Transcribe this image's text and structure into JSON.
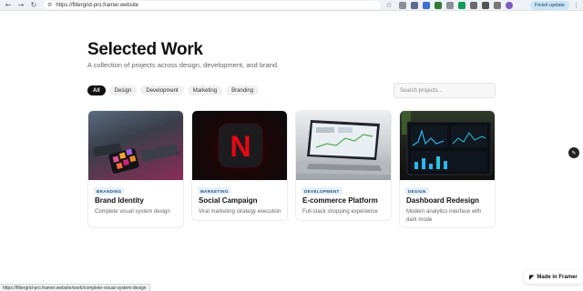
{
  "browser": {
    "url": "https://filtergrid-pro.framer.website",
    "finish_update_label": "Finish update",
    "status_url": "https://filtergrid-pro.framer.website/work/complete-visual-system-design"
  },
  "header": {
    "title": "Selected Work",
    "subtitle": "A collection of projects across design, development, and brand."
  },
  "filters": [
    {
      "label": "All",
      "active": true
    },
    {
      "label": "Design",
      "active": false
    },
    {
      "label": "Development",
      "active": false
    },
    {
      "label": "Marketing",
      "active": false
    },
    {
      "label": "Branding",
      "active": false
    }
  ],
  "search": {
    "placeholder": "Search projects..."
  },
  "projects": [
    {
      "tag": "BRANDING",
      "title": "Brand Identity",
      "description": "Complete visual system design"
    },
    {
      "tag": "MARKETING",
      "title": "Social Campaign",
      "description": "Viral marketing strategy execution"
    },
    {
      "tag": "DEVELOPMENT",
      "title": "E-commerce Platform",
      "description": "Full-stack shopping experience"
    },
    {
      "tag": "DESIGN",
      "title": "Dashboard Redesign",
      "description": "Modern analytics interface with dark mode"
    }
  ],
  "thumb_text": {
    "netflix_letter": "N"
  },
  "framer_badge": {
    "label": "Made in Framer"
  },
  "icons": {
    "back": "back-arrow-icon",
    "forward": "forward-arrow-icon",
    "reload": "reload-icon",
    "site_settings": "tune-icon",
    "bookmark": "star-icon",
    "edit_fab": "pencil-icon",
    "framer": "framer-logo-icon"
  },
  "colors": {
    "accent_dark": "#111111",
    "tag_bg": "#e4f0fb",
    "tag_text": "#1b4f7d",
    "finish_bg": "#c9e6f6"
  }
}
